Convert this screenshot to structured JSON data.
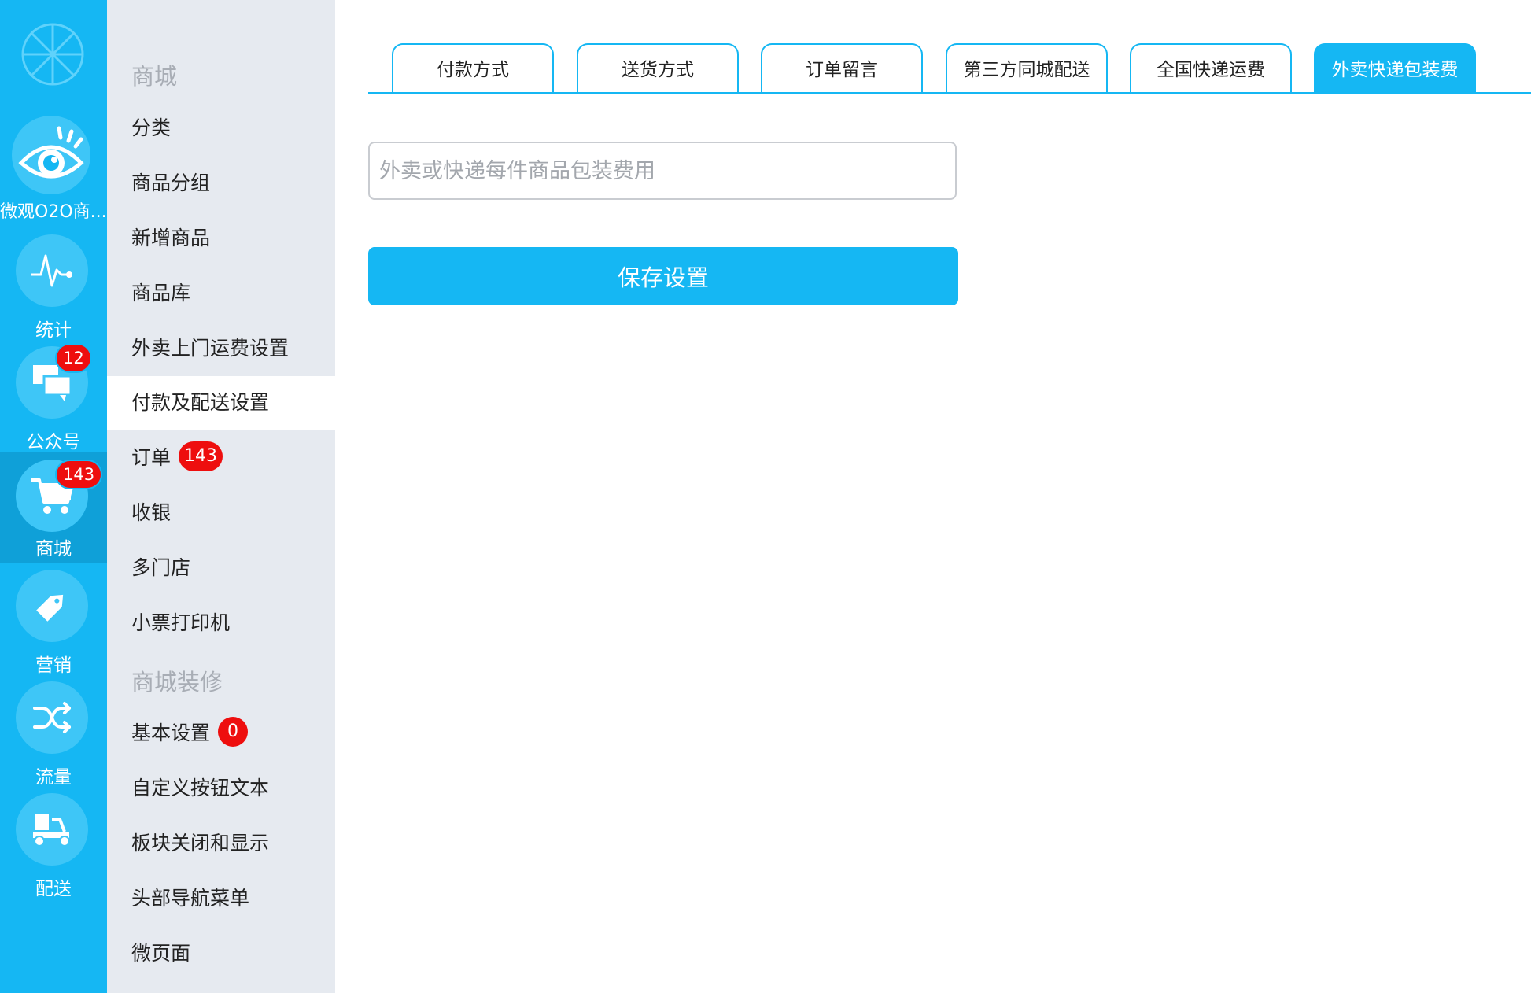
{
  "rail": {
    "app": {
      "label": "微观O2O商..."
    },
    "items": [
      {
        "label": "统计",
        "icon": "pulse-icon"
      },
      {
        "label": "公众号",
        "icon": "chat-icon",
        "badge": "12"
      },
      {
        "label": "商城",
        "icon": "cart-icon",
        "badge": "143",
        "active": true
      },
      {
        "label": "营销",
        "icon": "tag-icon"
      },
      {
        "label": "流量",
        "icon": "shuffle-icon"
      },
      {
        "label": "配送",
        "icon": "scooter-icon"
      }
    ]
  },
  "menu": {
    "section1": "商城",
    "items1": [
      "分类",
      "商品分组",
      "新增商品",
      "商品库",
      "外卖上门运费设置",
      "付款及配送设置",
      "订单",
      "收银",
      "多门店",
      "小票打印机"
    ],
    "order_badge": "143",
    "section2": "商城装修",
    "items2": [
      "基本设置",
      "自定义按钮文本",
      "板块关闭和显示",
      "头部导航菜单",
      "微页面"
    ],
    "basic_badge": "0"
  },
  "tabs": [
    "付款方式",
    "送货方式",
    "订单留言",
    "第三方同城配送",
    "全国快递运费",
    "外卖快递包装费"
  ],
  "active_tab": "外卖快递包装费",
  "form": {
    "fee_placeholder": "外卖或快递每件商品包装费用",
    "fee_value": "",
    "save_label": "保存设置"
  },
  "colors": {
    "accent": "#15b7f3",
    "badge": "#ee0e0e",
    "sidebar_bg": "#e6eaf0"
  }
}
